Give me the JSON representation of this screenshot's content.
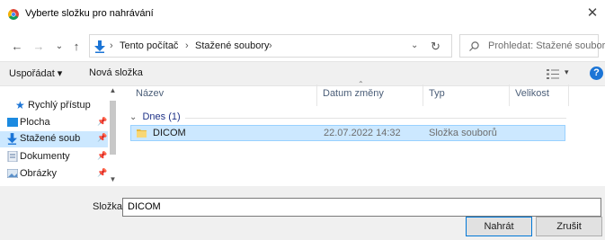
{
  "window": {
    "title": "Vyberte složku pro nahrávání",
    "close_glyph": "✕",
    "app_icon": "chrome-icon"
  },
  "nav_buttons": {
    "back": "←",
    "forward": "→",
    "recent": "⌄",
    "up": "↑"
  },
  "address": {
    "icon": "download-arrow-icon",
    "crumbs": [
      "Tento počítač",
      "Stažené soubory"
    ],
    "separator": "›",
    "dropdown_glyph": "⌄",
    "refresh_glyph": "↻"
  },
  "search": {
    "placeholder": "Prohledat: Stažené soubory"
  },
  "toolbar": {
    "organize_label": "Uspořádat ▾",
    "new_folder_label": "Nová složka",
    "view_dropdown": "▾",
    "help_label": "?"
  },
  "nav_pane": {
    "items": [
      {
        "label": "Rychlý přístup",
        "icon": "star-icon",
        "pinned": false,
        "selected": false
      },
      {
        "label": "Plocha",
        "icon": "desktop-icon",
        "pinned": true,
        "selected": false
      },
      {
        "label": "Stažené soub",
        "icon": "download-arrow-icon",
        "pinned": true,
        "selected": true
      },
      {
        "label": "Dokumenty",
        "icon": "documents-icon",
        "pinned": true,
        "selected": false
      },
      {
        "label": "Obrázky",
        "icon": "pictures-icon",
        "pinned": true,
        "selected": false
      }
    ],
    "pin_glyph": "📌",
    "scroll_up": "▲",
    "scroll_down": "▼"
  },
  "file_list": {
    "columns": [
      "Název",
      "Datum změny",
      "Typ",
      "Velikost"
    ],
    "sort_glyph": "⌃",
    "group": {
      "label": "Dnes (1)",
      "chevron": "⌄"
    },
    "rows": [
      {
        "name": "DICOM",
        "date": "22.07.2022 14:32",
        "type": "Složka souborů",
        "size": ""
      }
    ]
  },
  "bottom": {
    "folder_label": "Složka:",
    "folder_value": "DICOM",
    "upload_label": "Nahrát",
    "cancel_label": "Zrušit"
  },
  "colors": {
    "selection": "#cce8ff",
    "selection_border": "#99d1ff",
    "accent": "#0078d7",
    "folder": "#f8d775"
  }
}
